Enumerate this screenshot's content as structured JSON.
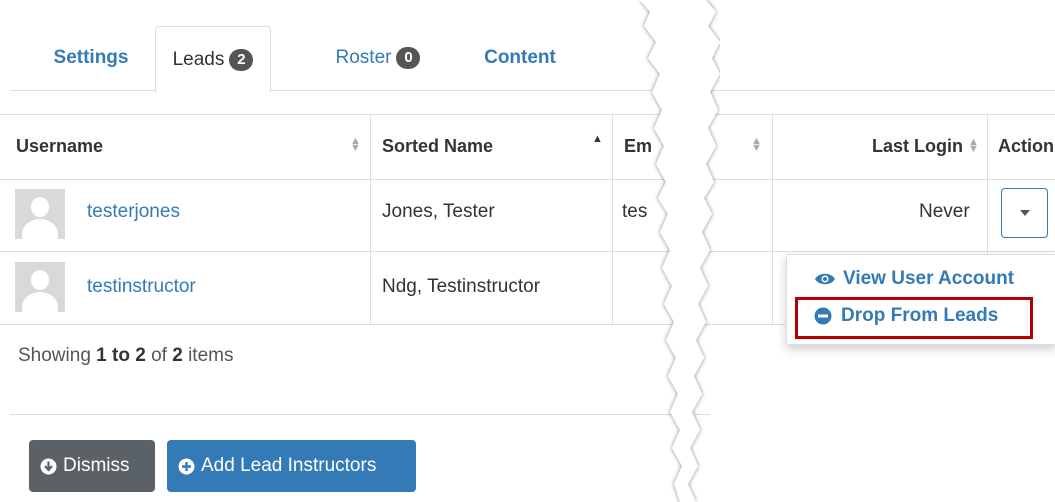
{
  "tabs": {
    "settings": "Settings",
    "leads": "Leads",
    "leads_count": "2",
    "roster": "Roster",
    "roster_count": "0",
    "content": "Content"
  },
  "table": {
    "headers": {
      "username": "Username",
      "sorted_name": "Sorted Name",
      "email": "Em",
      "last_login": "Last Login",
      "action": "Action"
    },
    "rows": [
      {
        "username": "testerjones",
        "sorted_name": "Jones, Tester",
        "email": "tes",
        "last_login": "Never"
      },
      {
        "username": "testinstructor",
        "sorted_name": "Ndg, Testinstructor",
        "email": "",
        "last_login": ""
      }
    ]
  },
  "dropdown_menu": {
    "view_account": "View User Account",
    "drop_leads": "Drop From Leads"
  },
  "footer": {
    "showing": "Showing",
    "range": "1 to 2",
    "of": "of",
    "total": "2",
    "items": "items"
  },
  "buttons": {
    "dismiss": "Dismiss",
    "add_lead": "Add Lead Instructors"
  },
  "colors": {
    "link": "#337ab7",
    "highlight": "#b30000",
    "dismiss_bg": "#5a6268"
  }
}
